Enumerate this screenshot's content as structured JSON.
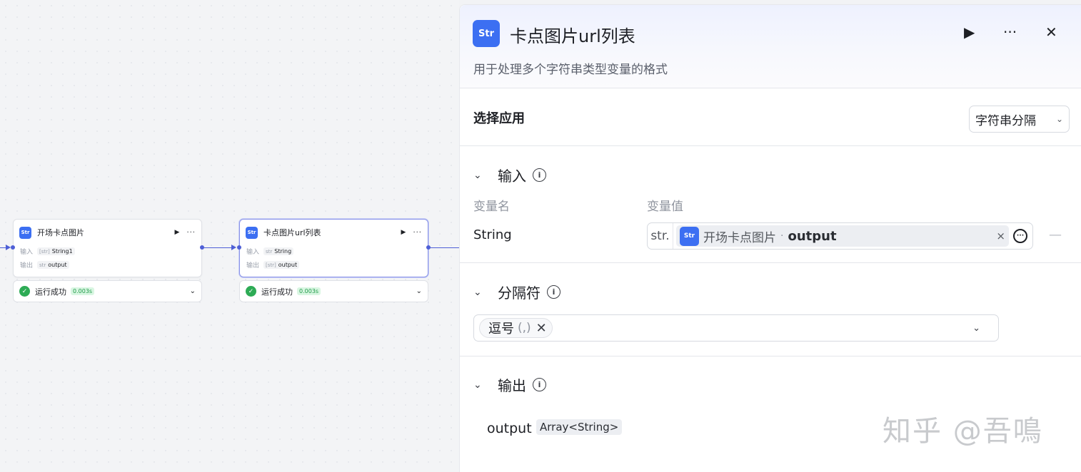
{
  "canvas": {
    "nodes": [
      {
        "title": "开场卡点图片",
        "icon": "string-plugin-icon",
        "input_label": "输入",
        "input_type": "[str]",
        "input_value": "String1",
        "output_label": "输出",
        "output_type": "str",
        "output_value": "output",
        "status_text": "运行成功",
        "status_time": "0.003s"
      },
      {
        "title": "卡点图片url列表",
        "icon": "string-plugin-icon",
        "input_label": "输入",
        "input_type": "str",
        "input_value": "String",
        "output_label": "输出",
        "output_type": "[str]",
        "output_value": "output",
        "status_text": "运行成功",
        "status_time": "0.003s"
      }
    ],
    "node_glyphs": {
      "run": "▶",
      "more": "···",
      "chevron": "⌄",
      "check": "✓"
    }
  },
  "panel": {
    "icon_text": "Str",
    "title": "卡点图片url列表",
    "description": "用于处理多个字符串类型变量的格式",
    "header_actions": {
      "run": "▶",
      "more": "···",
      "close": "✕"
    },
    "app_select": {
      "label": "选择应用",
      "value": "字符串分隔",
      "arrow": "⌄"
    },
    "input_section": {
      "title": "输入",
      "col_name": "变量名",
      "col_value": "变量值",
      "row": {
        "name": "String",
        "type_prefix": "str.",
        "source_node": "开场卡点图片",
        "separator": "·",
        "variable": "output",
        "clear": "×",
        "remove": "—"
      }
    },
    "separator_section": {
      "title": "分隔符",
      "selected_tag": {
        "name": "逗号",
        "symbol": "(,)",
        "remove": "✕"
      },
      "arrow": "⌄"
    },
    "output_section": {
      "title": "输出",
      "name": "output",
      "type": "Array<String>"
    }
  },
  "watermark": "知乎 @吾鳴",
  "colors": {
    "accent": "#4e5fd6",
    "icon_blue": "#3c6ff2",
    "success": "#2dab55",
    "success_bg": "#d9f6e2"
  }
}
